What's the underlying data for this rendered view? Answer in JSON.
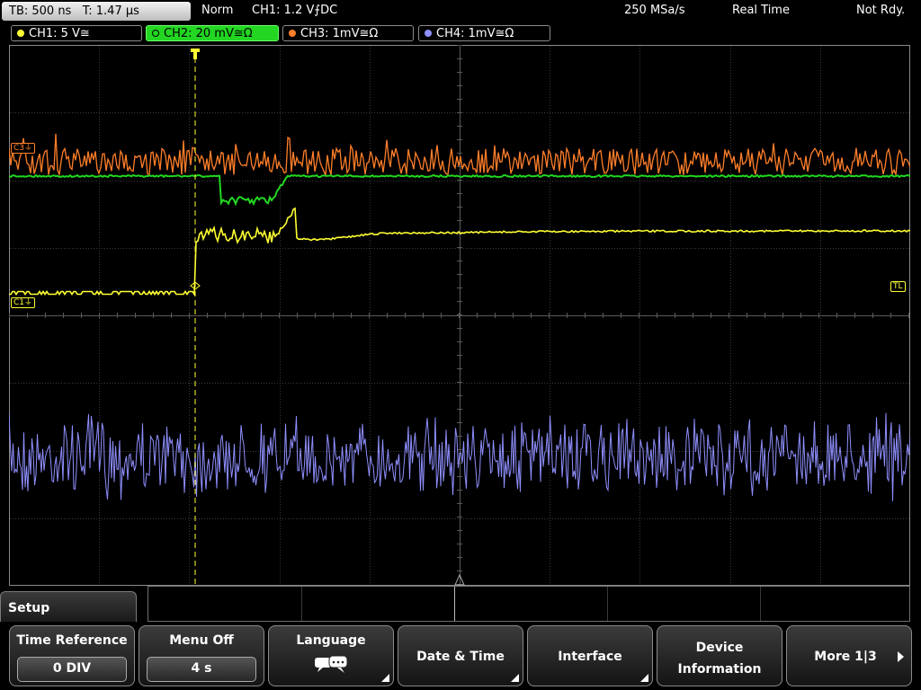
{
  "topbar": {
    "timebase": "TB: 500 ns",
    "trigger_time": "T: 1.47 µs",
    "mode": "Norm",
    "trigger_source": "CH1: 1.2 V",
    "trigger_slope": "⨍DC",
    "sample_rate": "250 MSa/s",
    "acq_mode": "Real Time",
    "status": "Not Rdy."
  },
  "channels": [
    {
      "label": "CH1: 5 V≅",
      "color": "#ffff33"
    },
    {
      "label": "CH2: 20 mV≅Ω",
      "color": "#22d622"
    },
    {
      "label": "CH3: 1mV≅Ω",
      "color": "#ff7f2a"
    },
    {
      "label": "CH4: 1mV≅Ω",
      "color": "#8f8fff"
    }
  ],
  "markers": {
    "c1": "C1⏚",
    "c3": "C3⏚",
    "trigger_level": "TL"
  },
  "menu": {
    "title": "Setup",
    "time_reference": {
      "label": "Time Reference",
      "value": "0 DIV"
    },
    "menu_off": {
      "label": "Menu Off",
      "value": "4 s"
    },
    "language": {
      "label": "Language",
      "icon": "speech-bubbles-icon"
    },
    "date_time": {
      "label": "Date & Time"
    },
    "interface": {
      "label": "Interface"
    },
    "device_info": {
      "line1": "Device",
      "line2": "Information"
    },
    "more": {
      "label": "More 1|3"
    }
  }
}
